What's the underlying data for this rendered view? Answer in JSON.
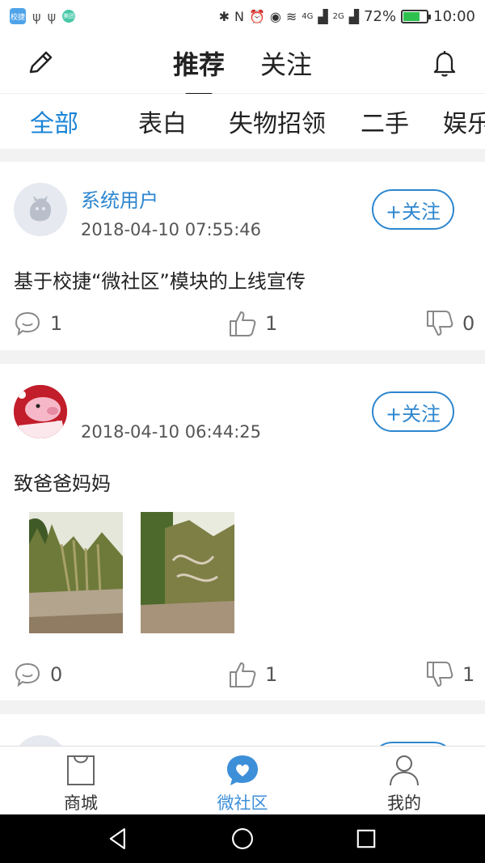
{
  "status_bar": {
    "app_badge": "校捷",
    "dot_badge": "美团",
    "network_4g": "4G",
    "network_2g": "2G",
    "battery_percent": "72%",
    "battery_level": 0.72,
    "time": "10:00"
  },
  "header": {
    "tabs": [
      {
        "label": "推荐",
        "active": true
      },
      {
        "label": "关注",
        "active": false
      }
    ]
  },
  "categories": [
    "全部",
    "表白",
    "失物招领",
    "二手",
    "娱乐"
  ],
  "active_category": "全部",
  "posts": [
    {
      "username": "系统用户",
      "time": "2018-04-10 07:55:46",
      "content": "基于校捷“微社区”模块的上线宣传",
      "follow_label": "+关注",
      "comments": "1",
      "likes": "1",
      "dislikes": "0"
    },
    {
      "username": "",
      "time": "2018-04-10 06:44:25",
      "content": "致爸爸妈妈",
      "follow_label": "+关注",
      "comments": "0",
      "likes": "1",
      "dislikes": "1",
      "photos": [
        "photo-1",
        "photo-2"
      ]
    }
  ],
  "bottom_nav": [
    {
      "label": "商城",
      "icon": "bag-icon",
      "active": false
    },
    {
      "label": "微社区",
      "icon": "chat-heart-icon",
      "active": true
    },
    {
      "label": "我的",
      "icon": "person-icon",
      "active": false
    }
  ],
  "colors": {
    "accent": "#1a84d6",
    "follow": "#2d86cf",
    "feed_bg": "#f2f2f2"
  }
}
